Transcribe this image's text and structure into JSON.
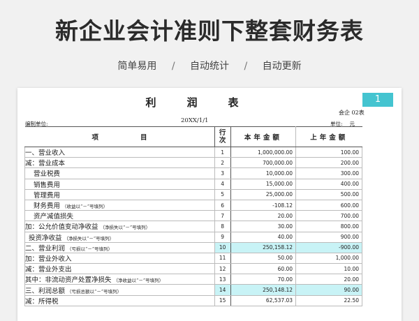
{
  "header": {
    "title": "新企业会计准则下整套财务表",
    "features": [
      "简单易用",
      "自动统计",
      "自动更新"
    ],
    "separator": "/"
  },
  "sheet": {
    "title": "利润表",
    "page_number": "1",
    "form_code": "会企 02表",
    "date": "20XX/1/1",
    "org_label": "编制单位:",
    "unit_label": "单位:",
    "unit_value": "元"
  },
  "table": {
    "headers": {
      "item": "项目",
      "no": "行次",
      "current": "本年金额",
      "previous": "上年金额"
    },
    "rows": [
      {
        "item": "一、营业收入",
        "note": "",
        "indent": 0,
        "no": "1",
        "current": "1,000,000.00",
        "previous": "100.00",
        "highlight": false
      },
      {
        "item": "减：营业成本",
        "note": "",
        "indent": 0,
        "no": "2",
        "current": "700,000.00",
        "previous": "200.00",
        "highlight": false
      },
      {
        "item": "营业税费",
        "note": "",
        "indent": 1,
        "no": "3",
        "current": "10,000.00",
        "previous": "300.00",
        "highlight": false
      },
      {
        "item": "销售费用",
        "note": "",
        "indent": 1,
        "no": "4",
        "current": "15,000.00",
        "previous": "400.00",
        "highlight": false
      },
      {
        "item": "管理费用",
        "note": "",
        "indent": 1,
        "no": "5",
        "current": "25,000.00",
        "previous": "500.00",
        "highlight": false
      },
      {
        "item": "财务费用",
        "note": "（收益以“－”号填列）",
        "indent": 1,
        "no": "6",
        "current": "-108.12",
        "previous": "600.00",
        "highlight": false
      },
      {
        "item": "资产减值损失",
        "note": "",
        "indent": 1,
        "no": "7",
        "current": "20.00",
        "previous": "700.00",
        "highlight": false
      },
      {
        "item": "加：公允价值变动净收益",
        "note": "（净损失以“－”号填列）",
        "indent": 0,
        "no": "8",
        "current": "30.00",
        "previous": "800.00",
        "highlight": false
      },
      {
        "item": "投资净收益",
        "note": "（净损失以“－”号填列）",
        "indent": 2,
        "no": "9",
        "current": "40.00",
        "previous": "900.00",
        "highlight": false
      },
      {
        "item": "二、营业利润",
        "note": "（亏损以“－”号填列）",
        "indent": 0,
        "no": "10",
        "current": "250,158.12",
        "previous": "-900.00",
        "highlight": true
      },
      {
        "item": "加：营业外收入",
        "note": "",
        "indent": 0,
        "no": "11",
        "current": "50.00",
        "previous": "1,000.00",
        "highlight": false
      },
      {
        "item": "减：营业外支出",
        "note": "",
        "indent": 0,
        "no": "12",
        "current": "60.00",
        "previous": "10.00",
        "highlight": false
      },
      {
        "item": "其中：非流动资产处置净损失",
        "note": "（净收益以“－”号填列）",
        "indent": 0,
        "no": "13",
        "current": "70.00",
        "previous": "20.00",
        "highlight": false
      },
      {
        "item": "三、利润总额",
        "note": "（亏损总额以“－”号填列）",
        "indent": 0,
        "no": "14",
        "current": "250,148.12",
        "previous": "90.00",
        "highlight": true
      },
      {
        "item": "减：所得税",
        "note": "",
        "indent": 0,
        "no": "15",
        "current": "62,537.03",
        "previous": "22.50",
        "highlight": false
      }
    ]
  }
}
